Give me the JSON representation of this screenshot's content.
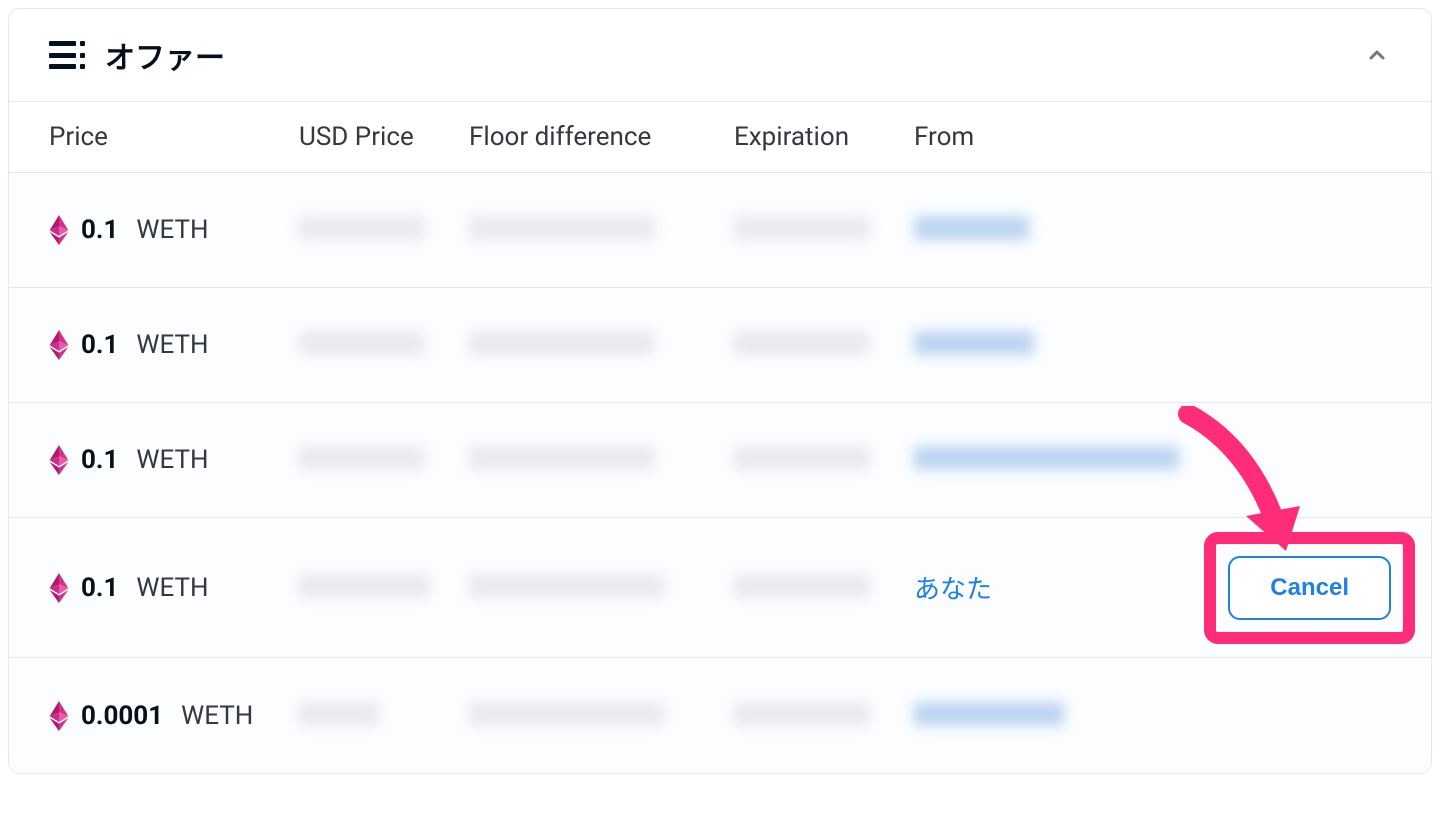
{
  "panel": {
    "title": "オファー"
  },
  "columns": {
    "price": "Price",
    "usd": "USD Price",
    "floor": "Floor difference",
    "expiration": "Expiration",
    "from": "From"
  },
  "rows": [
    {
      "amount": "0.1",
      "token": "WETH",
      "from_blurred": true,
      "from_text": "",
      "usd_w": 125,
      "floor_w": 185,
      "exp_w": 135,
      "from_w": 115,
      "is_you": false
    },
    {
      "amount": "0.1",
      "token": "WETH",
      "from_blurred": true,
      "from_text": "",
      "usd_w": 125,
      "floor_w": 185,
      "exp_w": 135,
      "from_w": 120,
      "is_you": false
    },
    {
      "amount": "0.1",
      "token": "WETH",
      "from_blurred": true,
      "from_text": "",
      "usd_w": 125,
      "floor_w": 185,
      "exp_w": 135,
      "from_w": 265,
      "is_you": false
    },
    {
      "amount": "0.1",
      "token": "WETH",
      "from_blurred": false,
      "from_text": "あなた",
      "usd_w": 130,
      "floor_w": 195,
      "exp_w": 135,
      "from_w": 0,
      "is_you": true
    },
    {
      "amount": "0.0001",
      "token": "WETH",
      "from_blurred": true,
      "from_text": "",
      "usd_w": 80,
      "floor_w": 195,
      "exp_w": 135,
      "from_w": 150,
      "is_you": false
    }
  ],
  "buttons": {
    "cancel": "Cancel"
  }
}
